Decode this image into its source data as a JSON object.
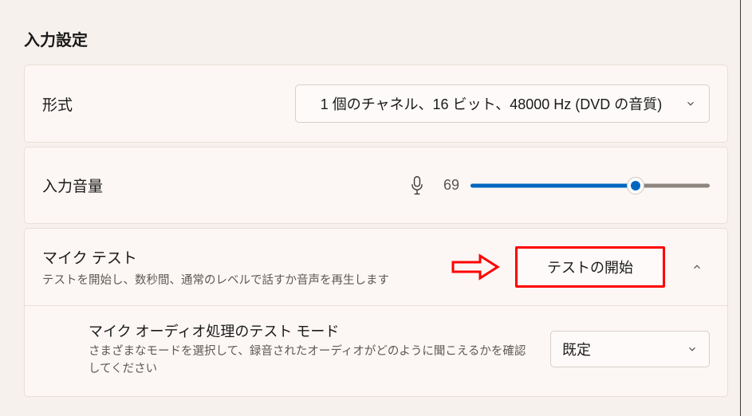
{
  "section": {
    "title": "入力設定"
  },
  "format": {
    "label": "形式",
    "value": "1 個のチャネル、16 ビット、48000 Hz (DVD の音質)"
  },
  "volume": {
    "label": "入力音量",
    "value": "69",
    "percent": 69
  },
  "micTest": {
    "title": "マイク テスト",
    "description": "テストを開始し、数秒間、通常のレベルで話すか音声を再生します",
    "button": "テストの開始"
  },
  "processingMode": {
    "title": "マイク オーディオ処理のテスト モード",
    "description": "さまざまなモードを選択して、録音されたオーディオがどのように聞こえるかを確認してください",
    "value": "既定"
  },
  "annotation": {
    "arrow_color": "#ff0000"
  }
}
